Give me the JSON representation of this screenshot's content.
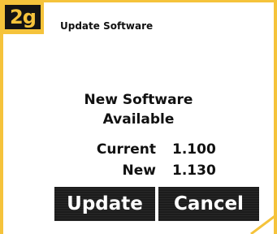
{
  "badge": {
    "label": "2g"
  },
  "header": {
    "title": "Update Software"
  },
  "main": {
    "heading_line1": "New Software",
    "heading_line2": "Available",
    "current_label": "Current",
    "current_value": "1.100",
    "new_label": "New",
    "new_value": "1.130"
  },
  "buttons": {
    "update_label": "Update",
    "cancel_label": "Cancel"
  },
  "colors": {
    "accent": "#f5c33b",
    "button_bg": "#1c1c1c",
    "text": "#111111"
  }
}
